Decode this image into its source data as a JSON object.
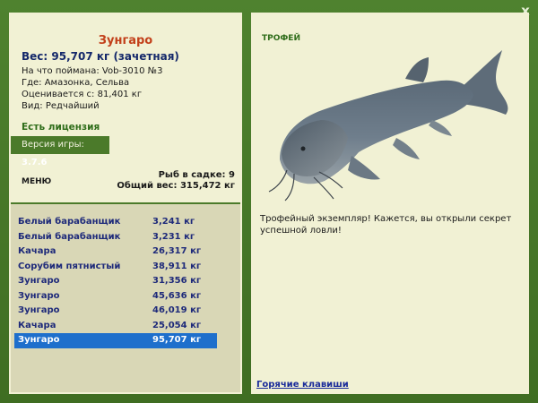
{
  "window": {
    "close_label": "x"
  },
  "fish": {
    "name": "Зунгаро",
    "weight": "Вес: 95,707 кг (зачетная)",
    "bait": "На что поймана: Vob-3010 №3",
    "location": "Где: Амазонка, Сельва",
    "price": "Оценивается с: 81,401 кг",
    "rarity": "Вид: Редчайший"
  },
  "license": {
    "label": "Есть лицензия"
  },
  "version": {
    "prefix": "Версия игры:",
    "value": "3.7.6"
  },
  "menu": {
    "label": "МЕНЮ"
  },
  "stats": {
    "fish_in_keepnet": "Рыб в садке: 9",
    "total_weight": "Общий вес: 315,472 кг"
  },
  "catch_list": [
    {
      "fish": "Белый барабанщик",
      "weight": "3,241 кг",
      "selected": false
    },
    {
      "fish": "Белый барабанщик",
      "weight": "3,231 кг",
      "selected": false
    },
    {
      "fish": "Качара",
      "weight": "26,317 кг",
      "selected": false
    },
    {
      "fish": "Сорубим пятнистый",
      "weight": "38,911 кг",
      "selected": false
    },
    {
      "fish": "Зунгаро",
      "weight": "31,356 кг",
      "selected": false
    },
    {
      "fish": "Зунгаро",
      "weight": "45,636 кг",
      "selected": false
    },
    {
      "fish": "Зунгаро",
      "weight": "46,019 кг",
      "selected": false
    },
    {
      "fish": "Качара",
      "weight": "25,054 кг",
      "selected": false
    },
    {
      "fish": "Зунгаро",
      "weight": "95,707 кг",
      "selected": true
    }
  ],
  "trophy": {
    "title": "ТРОФЕЙ",
    "message": "Трофейный экземпляр! Кажется, вы открыли секрет успешной ловли!"
  },
  "hotkeys": {
    "label": "Горячие клавиши"
  },
  "colors": {
    "background": "#4a7a2c",
    "panel": "#f1f1d4",
    "list_background": "#d9d7b6",
    "selected_row": "#1e6fcc",
    "fish_name": "#c2401a",
    "weight_text": "#14286a",
    "license_text": "#2f6d1a"
  },
  "icons": {
    "close": "close-icon",
    "fish_image": "catfish-image"
  }
}
